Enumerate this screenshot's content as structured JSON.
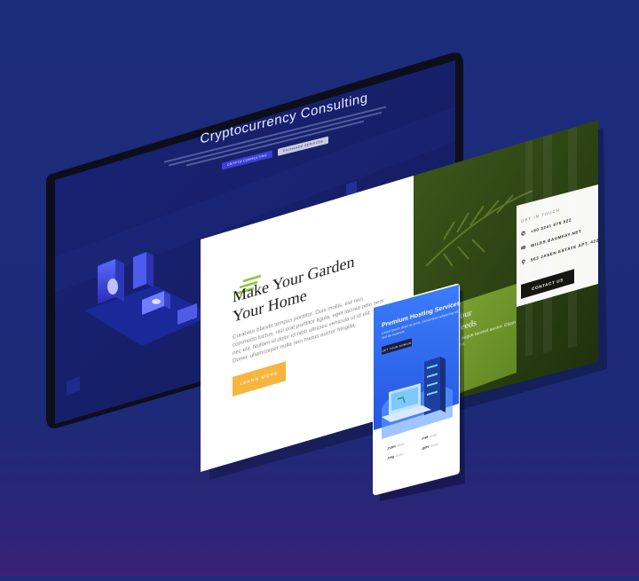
{
  "crypto": {
    "title": "Cryptocurrency Consulting",
    "buttons": [
      "CRYPTO CONSULTING",
      "EXCHANGE SERVICES"
    ],
    "accent": "#3d3fd8"
  },
  "garden": {
    "title_line1": "Make Your Garden",
    "title_line2": "Your Home",
    "body": "Curabitur blandit tempus porttitor. Duis mollis, est non commodo luctus, nisi erat porttitor ligula, eget lacinia odio sem nec elit. Nullam id dolor id nibh ultricies vehicula ut id elit. Donec ullamcorper nulla non metus auctor fringilla.",
    "button": "LEARN MORE",
    "accent": "#f5b53f",
    "contact": {
      "label": "GET IN TOUCH",
      "phone": "+90 3241 675 922",
      "email": "WILES.BAUMFAY.NET",
      "address": "563 JASEN ESTATE APT. 422",
      "button": "CONTACT US"
    },
    "green": {
      "heading_line1": "Your",
      "heading_line2": "Needs",
      "body": "vel augue laoreet auctor. Etiam porta"
    }
  },
  "hosting": {
    "title": "Premium Hosting Services",
    "subtitle": "Lorem ipsum dolor sit amet, consectetur adipiscing elit sed do eiusmod.",
    "button": "GET YOUR DOMAIN",
    "domains": [
      {
        "ext": ".com",
        "price": "$12/yr"
      },
      {
        "ext": ".net",
        "price": "$12/yr"
      },
      {
        "ext": ".org",
        "price": "$12/yr"
      },
      {
        "ext": ".gov",
        "price": "$12/yr"
      }
    ]
  }
}
